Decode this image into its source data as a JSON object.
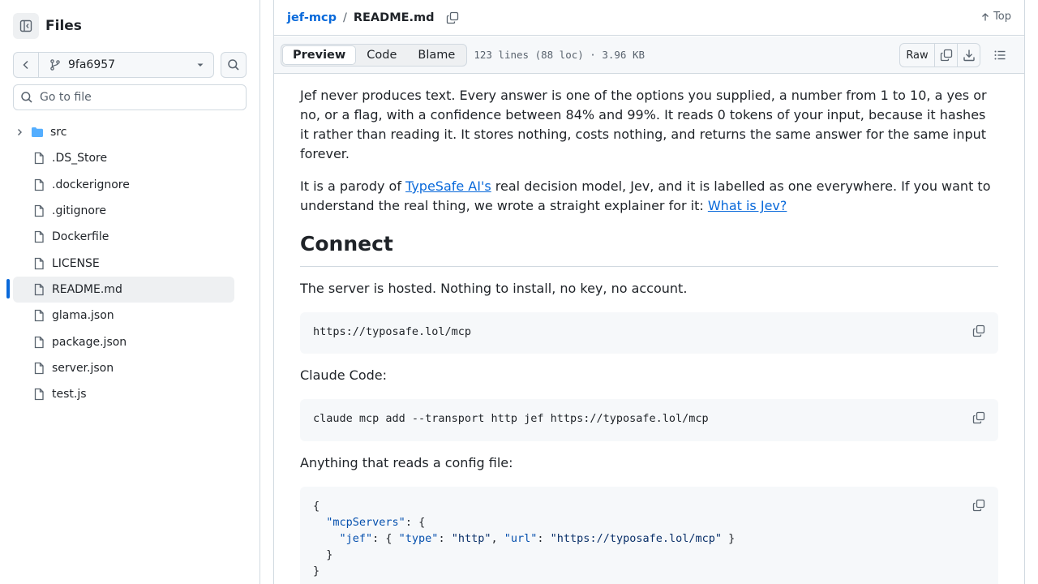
{
  "sidebar": {
    "title": "Files",
    "branch": "9fa6957",
    "goto_placeholder": "Go to file",
    "tree": [
      {
        "name": "src",
        "type": "folder"
      },
      {
        "name": ".DS_Store",
        "type": "file"
      },
      {
        "name": ".dockerignore",
        "type": "file"
      },
      {
        "name": ".gitignore",
        "type": "file"
      },
      {
        "name": "Dockerfile",
        "type": "file"
      },
      {
        "name": "LICENSE",
        "type": "file"
      },
      {
        "name": "README.md",
        "type": "file",
        "active": true
      },
      {
        "name": "glama.json",
        "type": "file"
      },
      {
        "name": "package.json",
        "type": "file"
      },
      {
        "name": "server.json",
        "type": "file"
      },
      {
        "name": "test.js",
        "type": "file"
      }
    ]
  },
  "header": {
    "repo": "jef-mcp",
    "separator": "/",
    "file": "README.md",
    "top_label": "Top"
  },
  "toolbar": {
    "tabs": [
      "Preview",
      "Code",
      "Blame"
    ],
    "active_tab": "Preview",
    "meta": "123 lines (88 loc) · 3.96 KB",
    "raw_label": "Raw"
  },
  "readme": {
    "p1": "Jef never produces text. Every answer is one of the options you supplied, a number from 1 to 10, a yes or no, or a flag, with a confidence between 84% and 99%. It reads 0 tokens of your input, because it hashes it rather than reading it. It stores nothing, costs nothing, and returns the same answer for the same input forever.",
    "p2_before": "It is a parody of ",
    "p2_link1": "TypeSafe AI's",
    "p2_middle": " real decision model, Jev, and it is labelled as one everywhere. If you want to understand the real thing, we wrote a straight explainer for it: ",
    "p2_link2": "What is Jev?",
    "h2": "Connect",
    "p3": "The server is hosted. Nothing to install, no key, no account.",
    "code1": "https://typosafe.lol/mcp",
    "p4": "Claude Code:",
    "code2": "claude mcp add --transport http jef https://typosafe.lol/mcp",
    "p5": "Anything that reads a config file:",
    "code3": {
      "open": "{",
      "servers_key": "\"mcpServers\"",
      "jef_key": "\"jef\"",
      "type_key": "\"type\"",
      "type_val": "\"http\"",
      "url_key": "\"url\"",
      "url_val": "\"https://typosafe.lol/mcp\"",
      "inner_close": "}",
      "close": "}"
    }
  },
  "colors": {
    "accent": "#0969da",
    "border": "#d1d9e0",
    "folder": "#54aeff",
    "muted": "#59636e"
  }
}
